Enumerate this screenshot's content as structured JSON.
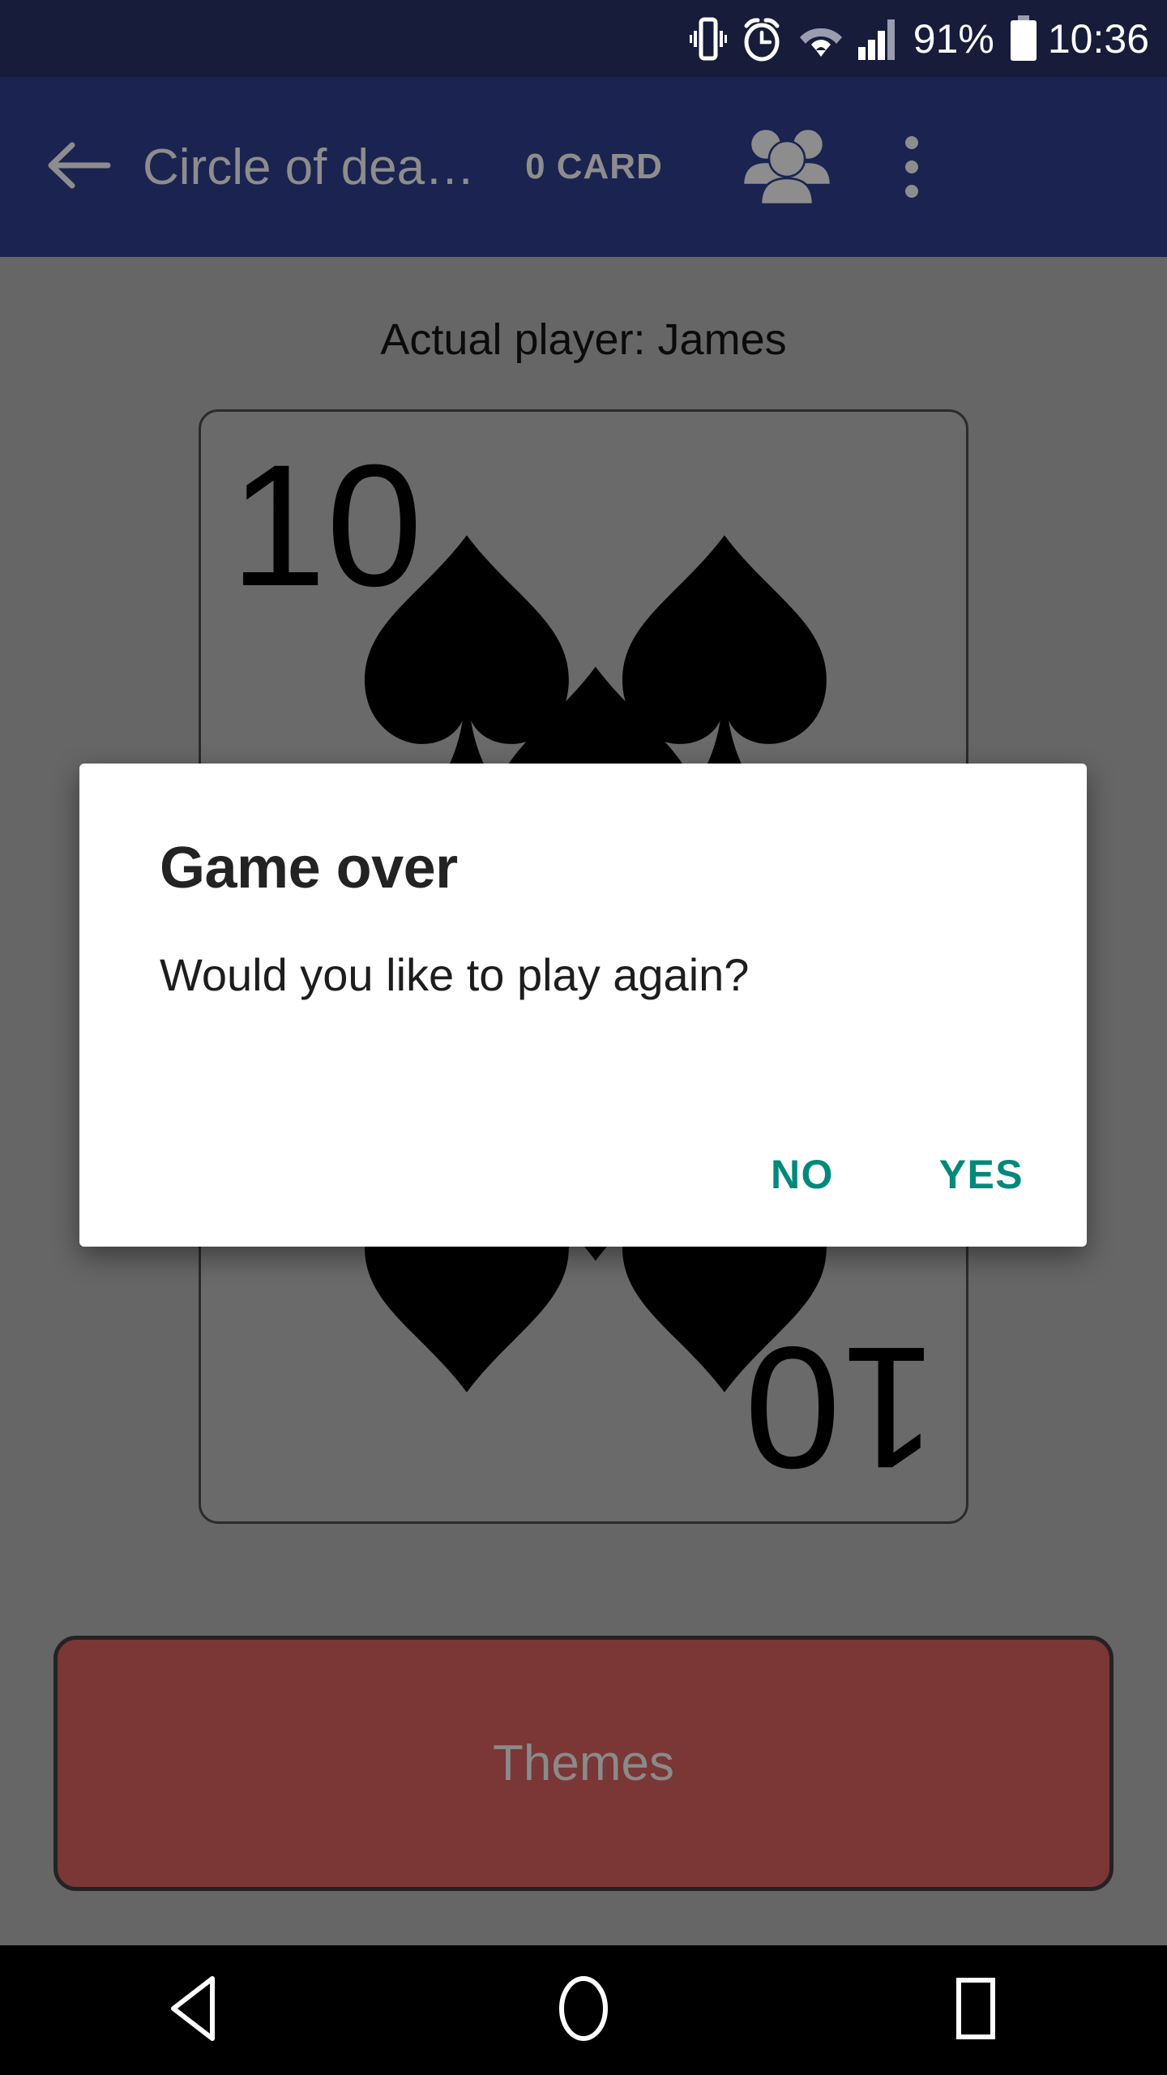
{
  "status_bar": {
    "battery_percent": "91%",
    "clock": "10:36",
    "icons": [
      "vibrate-icon",
      "alarm-icon",
      "wifi-icon",
      "signal-icon",
      "battery-icon"
    ],
    "background_color": "#161c3a",
    "text_color": "#ffffff"
  },
  "app_bar": {
    "back_label": "back-arrow-icon",
    "title": "Circle of dea…",
    "card_count": "0 CARD",
    "players_icon": "people-group-icon",
    "overflow_icon": "more-vert-icon",
    "background_color": "#1b2350",
    "dimmed_text_color": "#8d8d8d"
  },
  "game": {
    "actual_player_text": "Actual player: James",
    "card": {
      "rank": "10",
      "suit": "spades",
      "suit_glyph": "♠",
      "pip_count": 10,
      "border_color": "#2b2b2b"
    },
    "themes_button_label": "Themes",
    "themes_button_color": "#7b3636",
    "background_color": "#666666"
  },
  "dialog": {
    "title": "Game over",
    "message": "Would you like to play again?",
    "no_label": "NO",
    "yes_label": "YES",
    "accent_color": "#00897b",
    "background_color": "#ffffff"
  },
  "nav_bar": {
    "back_icon": "nav-back-triangle-icon",
    "home_icon": "nav-home-circle-icon",
    "recents_icon": "nav-recents-square-icon",
    "background_color": "#000000"
  }
}
